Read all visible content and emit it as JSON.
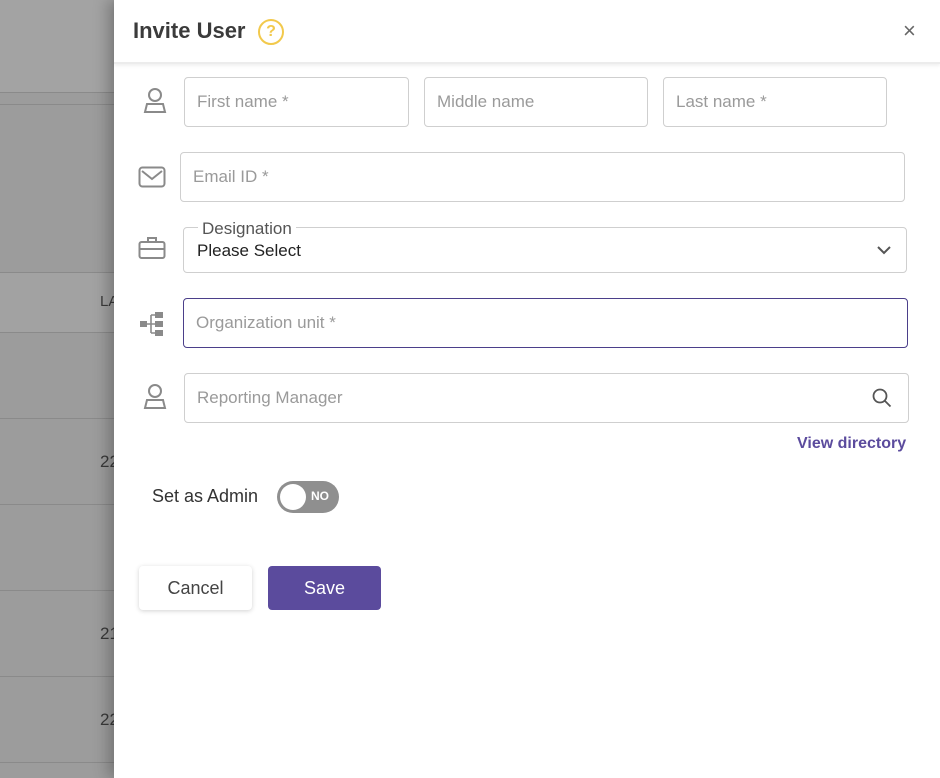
{
  "background": {
    "column_header_partial": "LA",
    "row_values_partial": [
      "22",
      "21",
      "22"
    ]
  },
  "dialog": {
    "title": "Invite User",
    "help_icon": "question-circle-icon",
    "close_icon": "close-icon",
    "close_glyph": "×"
  },
  "form": {
    "first_name_placeholder": "First name *",
    "middle_name_placeholder": "Middle name",
    "last_name_placeholder": "Last name *",
    "email_placeholder": "Email ID *",
    "designation_label": "Designation",
    "designation_value": "Please Select",
    "org_unit_placeholder": "Organization unit *",
    "reporting_manager_placeholder": "Reporting Manager",
    "view_directory": "View directory",
    "set_as_admin_label": "Set as Admin",
    "admin_toggle_state": "NO"
  },
  "actions": {
    "cancel": "Cancel",
    "save": "Save"
  },
  "colors": {
    "accent": "#5b4b9d",
    "help": "#f2c94c",
    "toggle_off": "#8f8f8f"
  }
}
